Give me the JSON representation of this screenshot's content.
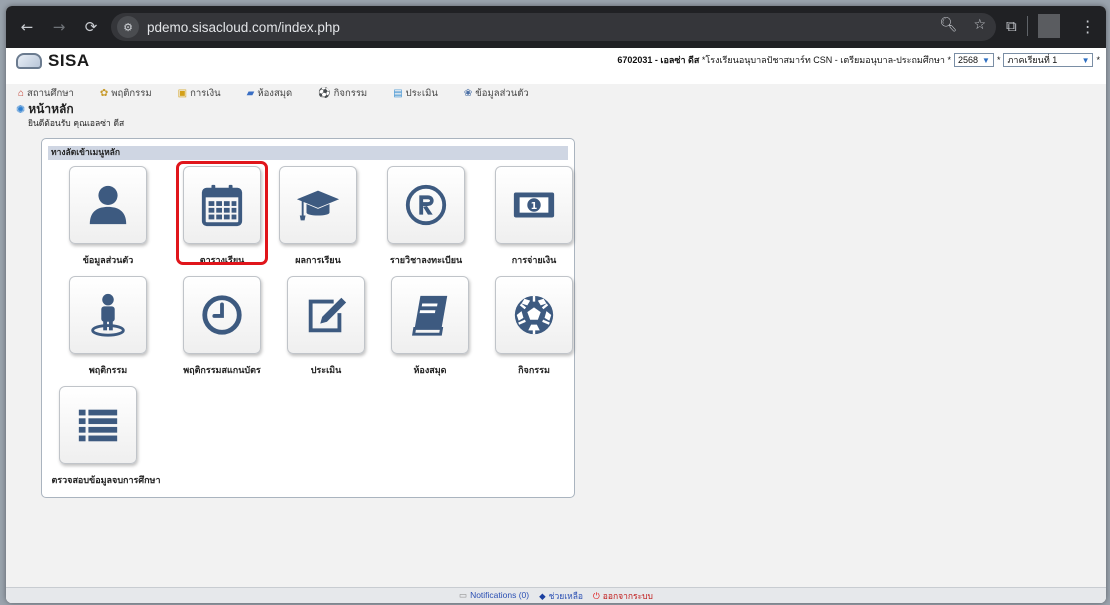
{
  "browser": {
    "url": "pdemo.sisacloud.com/index.php"
  },
  "header": {
    "logo_text": "SISA",
    "student_info": "6702031 - เอลซ่า ดีส",
    "school_info": "โรงเรียนอนุบาลปัชาสมาร์ท CSN - เตรียมอนุบาล-ประถมศึกษา",
    "year_value": "2568",
    "term_value": "ภาคเรียนที่ 1"
  },
  "topnav": [
    {
      "label": "สถานศึกษา"
    },
    {
      "label": "พฤติกรรม"
    },
    {
      "label": "การเงิน"
    },
    {
      "label": "ห้องสมุด"
    },
    {
      "label": "กิจกรรม"
    },
    {
      "label": "ประเมิน"
    },
    {
      "label": "ข้อมูลส่วนตัว"
    }
  ],
  "home": {
    "title": "หน้าหลัก",
    "welcome": "ยินดีต้อนรับ คุณเอลซ่า ดีส"
  },
  "panel": {
    "heading": "ทางลัดเข้าเมนูหลัก",
    "tiles": [
      {
        "label": "ข้อมูลส่วนตัว",
        "icon": "user-icon"
      },
      {
        "label": "ตารางเรียน",
        "icon": "calendar-icon"
      },
      {
        "label": "ผลการเรียน",
        "icon": "graduation-cap-icon"
      },
      {
        "label": "รายวิชาลงทะเบียน",
        "icon": "registered-icon"
      },
      {
        "label": "การจ่ายเงิน",
        "icon": "money-bill-icon"
      },
      {
        "label": "พฤติกรรม",
        "icon": "person-pin-icon"
      },
      {
        "label": "พฤติกรรมสแกนบัตร",
        "icon": "clock-icon"
      },
      {
        "label": "ประเมิน",
        "icon": "edit-icon"
      },
      {
        "label": "ห้องสมุด",
        "icon": "book-icon"
      },
      {
        "label": "กิจกรรม",
        "icon": "soccer-ball-icon"
      },
      {
        "label": "ตรวจสอบข้อมูลจบการศึกษา",
        "icon": "list-icon"
      }
    ]
  },
  "footer": {
    "notifications": "Notifications (0)",
    "help": "ช่วยเหลือ",
    "logout": "ออกจากระบบ"
  },
  "colors": {
    "icon_color": "#3d5a80",
    "highlight": "#e0151b",
    "panel_head": "#cfd6e3"
  }
}
